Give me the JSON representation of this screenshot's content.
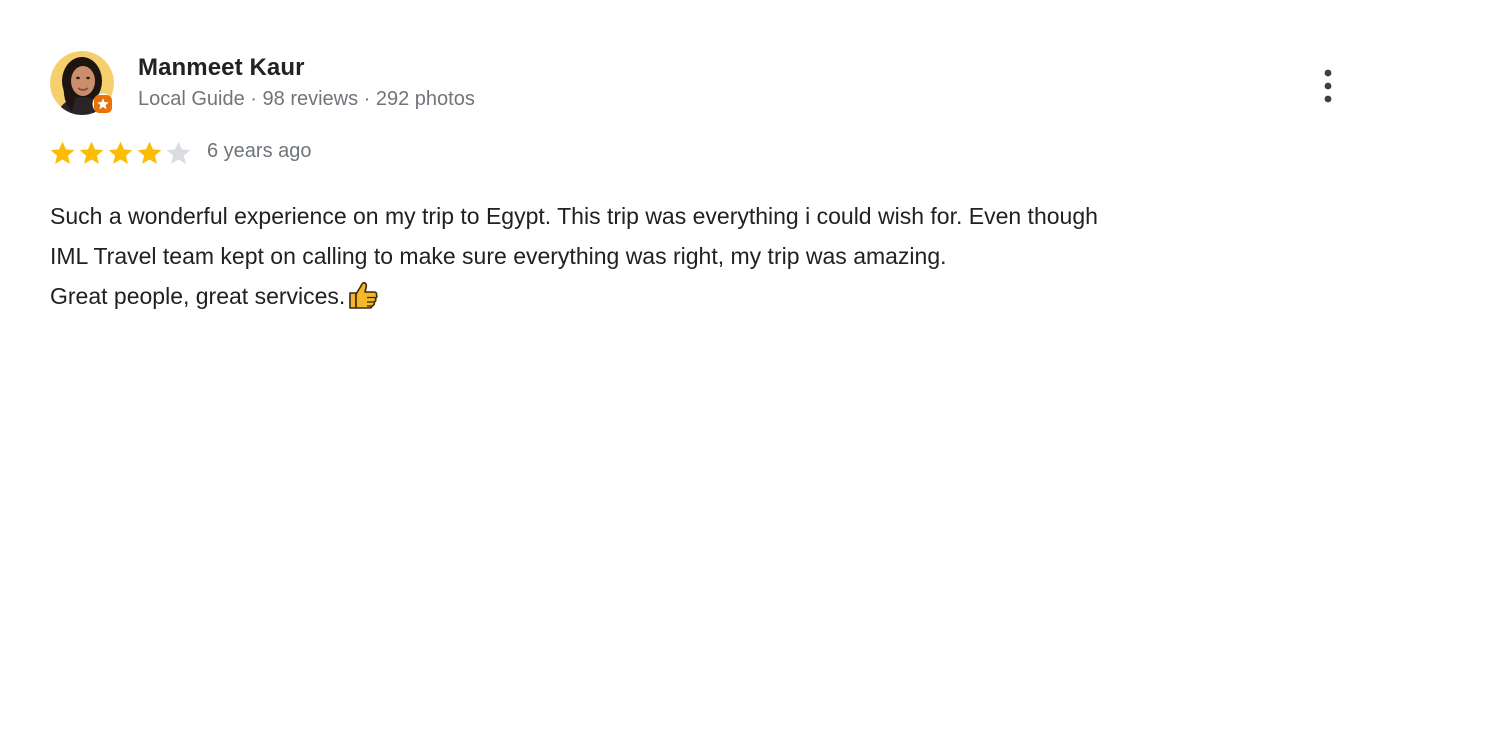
{
  "reviewer": {
    "name": "Manmeet Kaur",
    "meta": "Local Guide · 98 reviews · 292 photos",
    "avatar_icon": "profile-photo",
    "badge_icon": "local-guide-badge-icon",
    "badge_color": "#e8710a"
  },
  "review": {
    "rating": 4,
    "max_rating": 5,
    "date": "6 years ago",
    "star_color": "#fbbc04",
    "empty_star_color": "#dadce0",
    "lines": [
      "Such a wonderful experience on my trip to Egypt. This trip was everything i could wish for. Even though",
      "IML Travel team kept on calling to make sure everything was right, my trip was amazing.",
      "Great people, great services."
    ],
    "trailing_icon": "thumbs-up-icon"
  },
  "actions": {
    "more_icon": "more-vert-icon"
  }
}
